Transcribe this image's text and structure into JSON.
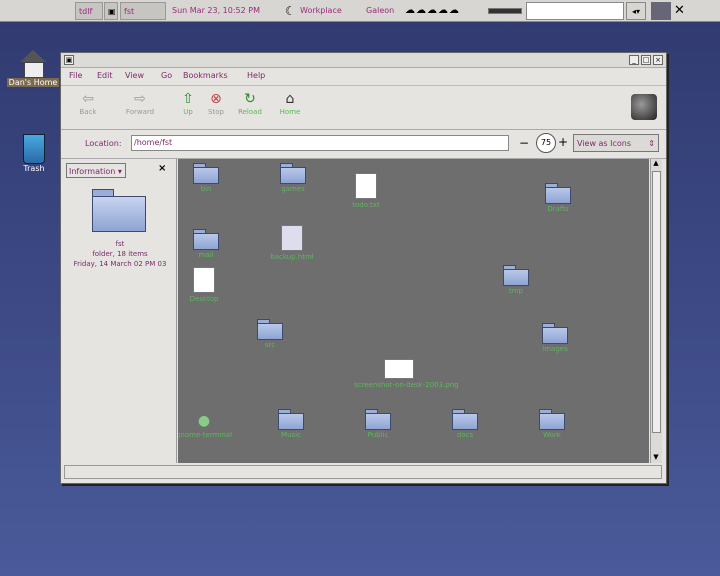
{
  "panel": {
    "task1": "tdlf",
    "task2": "fst",
    "datetime": "Sun Mar 23, 10:52 PM",
    "app1": "Workplace",
    "app2": "Galeon"
  },
  "desktop": {
    "home_label": "Dan's Home",
    "trash_label": "Trash"
  },
  "window": {
    "menus": [
      "File",
      "Edit",
      "View",
      "Go",
      "Bookmarks",
      "Help"
    ],
    "toolbar": {
      "back": "Back",
      "forward": "Forward",
      "up": "Up",
      "stop": "Stop",
      "reload": "Reload",
      "home": "Home"
    },
    "location_label": "Location:",
    "location_value": "/home/fst",
    "zoom_value": "75",
    "view_as": "View as Icons",
    "side": {
      "selector": "Information",
      "folder_name": "fst",
      "info_line1": "folder, 18 items",
      "info_line2": "Friday, 14 March 02 PM 03"
    },
    "items": [
      {
        "label": "bin"
      },
      {
        "label": "games"
      },
      {
        "label": "todo.txt"
      },
      {
        "label": "Drafts"
      },
      {
        "label": "mail"
      },
      {
        "label": "backup.html"
      },
      {
        "label": "Desktop"
      },
      {
        "label": "tmp"
      },
      {
        "label": "src"
      },
      {
        "label": "images"
      },
      {
        "label": "screenshot-on-desk-2003.png"
      },
      {
        "label": "gnome-terminal"
      },
      {
        "label": "Music"
      },
      {
        "label": "Public"
      },
      {
        "label": "docs"
      },
      {
        "label": "Work"
      }
    ]
  }
}
